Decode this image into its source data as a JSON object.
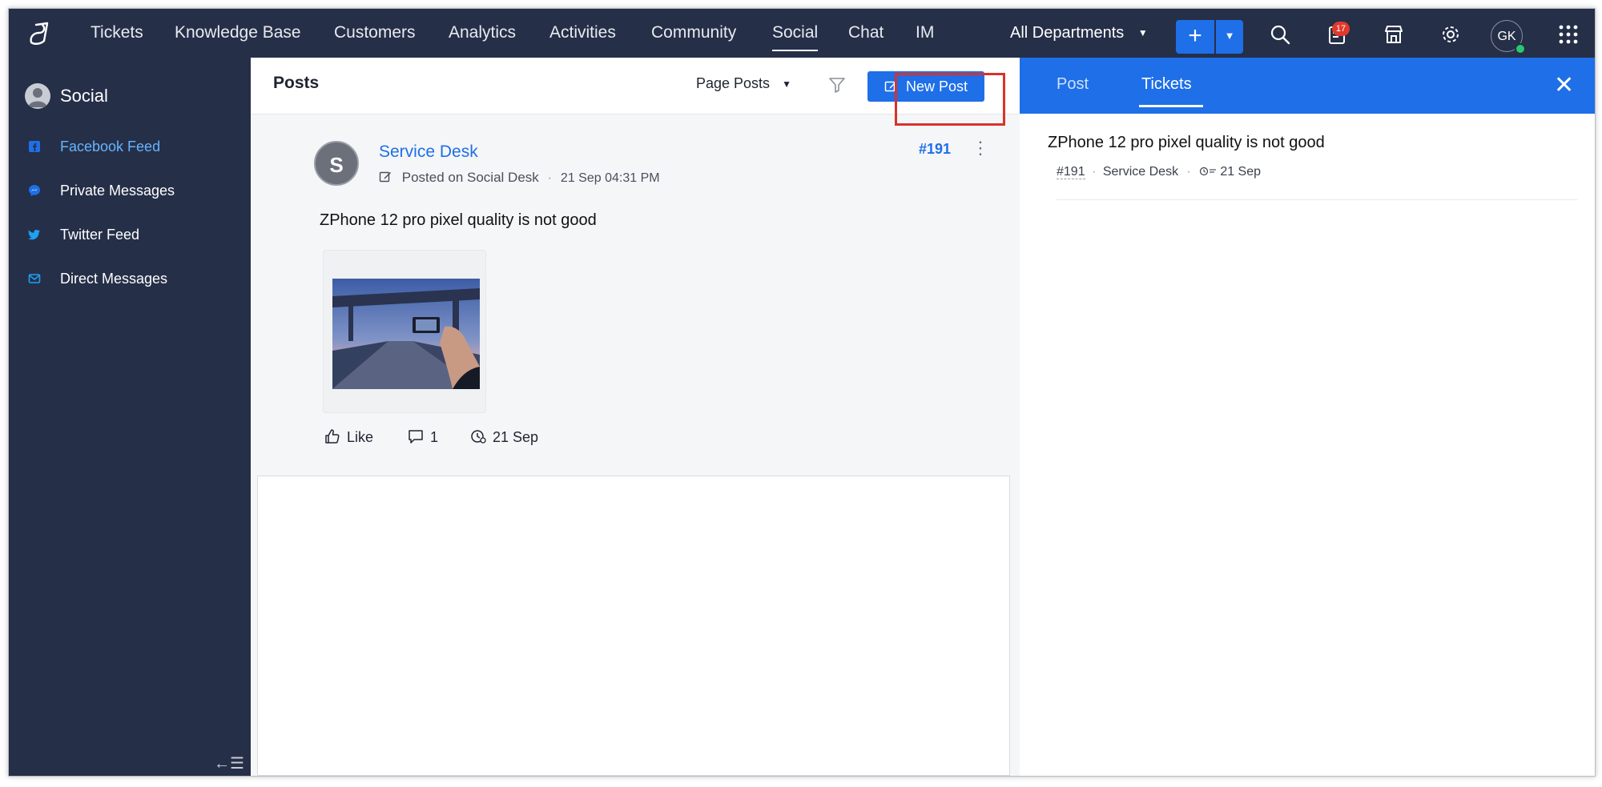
{
  "nav": {
    "items": [
      "Tickets",
      "Knowledge Base",
      "Customers",
      "Analytics",
      "Activities",
      "Community",
      "Social",
      "Chat",
      "IM"
    ],
    "active": "Social",
    "department": "All Departments",
    "notification_count": "17",
    "user_initials": "GK"
  },
  "sidebar": {
    "title": "Social",
    "items": [
      {
        "label": "Facebook Feed",
        "icon": "facebook-icon",
        "active": true
      },
      {
        "label": "Private Messages",
        "icon": "messenger-icon"
      },
      {
        "label": "Twitter Feed",
        "icon": "twitter-icon"
      },
      {
        "label": "Direct Messages",
        "icon": "mail-icon"
      }
    ],
    "collapse_glyph": "←☰"
  },
  "posts": {
    "title": "Posts",
    "filter_label": "Page Posts",
    "new_post_label": "New Post",
    "post": {
      "avatar_letter": "S",
      "author": "Service Desk",
      "posted_on": "Posted on Social Desk",
      "timestamp": "21 Sep 04:31 PM",
      "id": "#191",
      "text": "ZPhone 12 pro pixel quality is not good",
      "like_label": "Like",
      "comment_count": "1",
      "date": "21 Sep"
    }
  },
  "panel": {
    "tabs": [
      "Post",
      "Tickets"
    ],
    "active_tab": "Tickets",
    "ticket": {
      "subject": "ZPhone 12 pro pixel quality is not good",
      "id": "#191",
      "department": "Service Desk",
      "date": "21 Sep"
    }
  },
  "colors": {
    "nav_bg": "#262f48",
    "accent": "#1e6fe8",
    "active_side": "#64b5ff",
    "highlight": "#d7332b"
  }
}
